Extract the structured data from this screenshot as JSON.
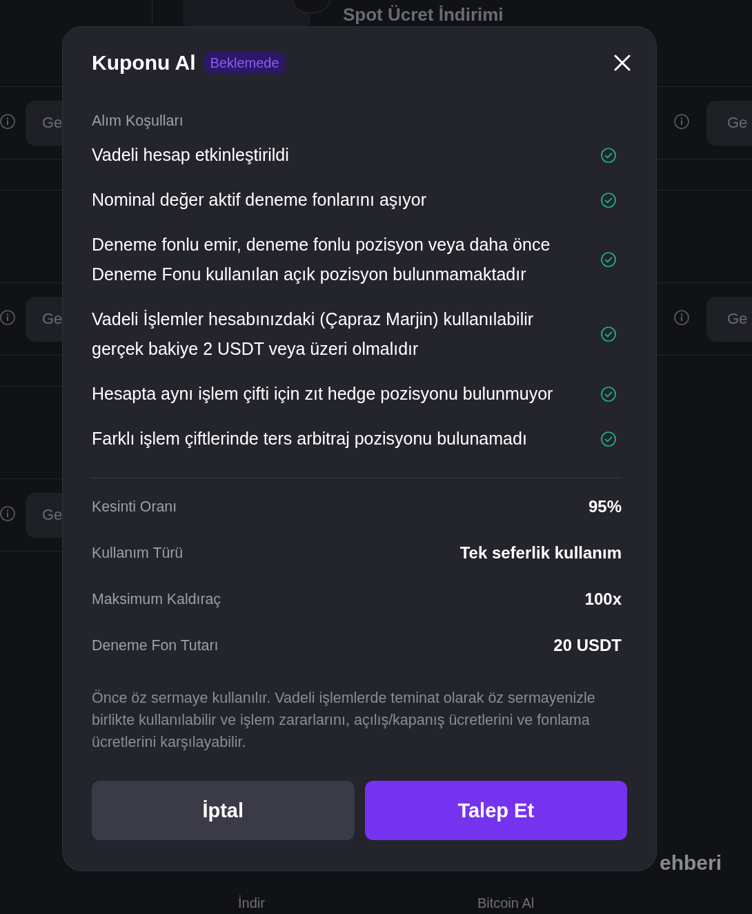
{
  "background": {
    "heading": "Spot Ücret İndirimi",
    "rows": [
      {
        "left_button": "Ge",
        "right_button": "Ge"
      },
      {
        "left_button": "Ge",
        "right_button": "Ge"
      },
      {
        "left_button": "Ge"
      }
    ],
    "footer": {
      "heading": "ehberi",
      "links": [
        "İndir",
        "Bitcoin Al"
      ]
    }
  },
  "modal": {
    "title": "Kuponu Al",
    "status_badge": "Beklemede",
    "conditions_title": "Alım Koşulları",
    "conditions": [
      {
        "text": "Vadeli hesap etkinleştirildi",
        "met": true
      },
      {
        "text": "Nominal değer aktif deneme fonlarını aşıyor",
        "met": true
      },
      {
        "text": "Deneme fonlu emir, deneme fonlu pozisyon veya daha önce Deneme Fonu kullanılan açık pozisyon bulunmamaktadır",
        "met": true
      },
      {
        "text": "Vadeli İşlemler hesabınızdaki (Çapraz Marjin) kullanılabilir gerçek bakiye 2 USDT veya üzeri olmalıdır",
        "met": true
      },
      {
        "text": "Hesapta aynı işlem çifti için zıt hedge pozisyonu bulunmuyor",
        "met": true
      },
      {
        "text": "Farklı işlem çiftlerinde ters arbitraj pozisyonu bulunamadı",
        "met": true
      }
    ],
    "details": [
      {
        "label": "Kesinti Oranı",
        "value": "95%"
      },
      {
        "label": "Kullanım Türü",
        "value": "Tek seferlik kullanım"
      },
      {
        "label": "Maksimum Kaldıraç",
        "value": "100x"
      },
      {
        "label": "Deneme Fon Tutarı",
        "value": "20 USDT"
      }
    ],
    "note": "Önce öz sermaye kullanılır. Vadeli işlemlerde teminat olarak öz sermayenizle birlikte kullanılabilir ve işlem zararlarını, açılış/kapanış ücretlerini ve fonlama ücretlerini karşılayabilir.",
    "buttons": [
      {
        "label": "İptal",
        "kind": "secondary"
      },
      {
        "label": "Talep Et",
        "kind": "primary"
      }
    ]
  }
}
